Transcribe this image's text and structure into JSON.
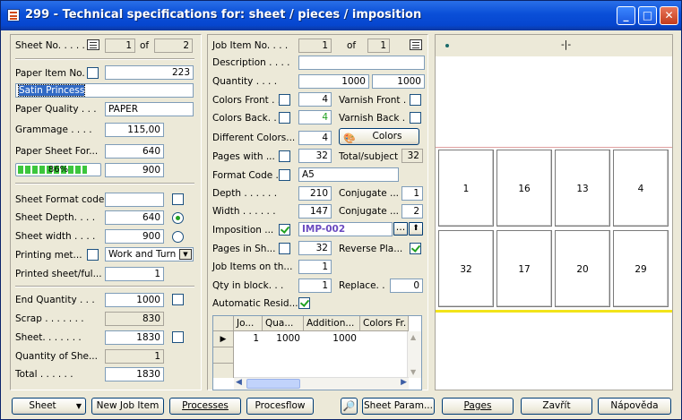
{
  "window": {
    "title": "299 - Technical specifications for: sheet / pieces / imposition",
    "minimize": "_",
    "maximize": "□",
    "close": "✕"
  },
  "left": {
    "sheet_no_label": "Sheet No. . . . .",
    "sheet_no": "1",
    "of_label": "of",
    "sheet_total": "2",
    "paper_item_label": "Paper Item No.",
    "paper_item": "223",
    "paper_name": "Satin Princess",
    "paper_quality_label": "Paper Quality . . .",
    "paper_quality": "PAPER",
    "grammage_label": "Grammage . . . .",
    "grammage": "115,00",
    "paper_sheet_label": "Paper Sheet For...",
    "paper_sheet_1": "640",
    "progress_text": "86%",
    "progress_value": 0.86,
    "paper_sheet_2": "900",
    "sheet_format_label": "Sheet Format code",
    "sheet_format": "",
    "sheet_depth_label": "Sheet Depth. . . .",
    "sheet_depth": "640",
    "sheet_width_label": "Sheet width . . . .",
    "sheet_width": "900",
    "printing_label": "Printing met...",
    "printing_method": "Work and Turn",
    "printed_label": "Printed sheet/ful...",
    "printed": "1",
    "end_qty_label": "End Quantity . . .",
    "end_qty": "1000",
    "scrap_label": "Scrap . . . . . . .",
    "scrap": "830",
    "sheet_label": "Sheet. . . . . . .",
    "sheet": "1830",
    "qty_she_label": "Quantity of She...",
    "qty_she": "1",
    "total_label": "Total . . . . . .",
    "total": "1830"
  },
  "middle": {
    "job_item_label": "Job Item No. . . .",
    "job_item": "1",
    "of_label": "of",
    "job_item_total": "1",
    "description_label": "Description . . . .",
    "description": "",
    "quantity_label": "Quantity . . . .",
    "quantity_1": "1000",
    "quantity_2": "1000",
    "colors_front_label": "Colors Front . .",
    "colors_front": "4",
    "varnish_front_label": "Varnish Front .",
    "colors_back_label": "Colors Back. . .",
    "colors_back": "4",
    "varnish_back_label": "Varnish Back .",
    "diff_colors_label": "Different Colors...",
    "diff_colors": "4",
    "colors_button": "Colors",
    "pages_with_label": "Pages with ...",
    "pages_with": "32",
    "total_subject_label": "Total/subject",
    "total_subject": "32",
    "format_code_label": "Format Code .",
    "format_code": "A5",
    "depth_label": "Depth . . . . . .",
    "depth": "210",
    "conjugate_label_1": "Conjugate ...",
    "conjugate_1": "1",
    "width_label": "Width . . . . . .",
    "width": "147",
    "conjugate_label_2": "Conjugate ...",
    "conjugate_2": "2",
    "imposition_label": "Imposition ...",
    "imposition": "IMP-002",
    "pages_in_sh_label": "Pages in Sh...",
    "pages_in_sh": "32",
    "reverse_label": "Reverse Pla...",
    "job_items_label": "Job Items on th...",
    "job_items": "1",
    "qty_block_label": "Qty in block. . .",
    "qty_block": "1",
    "replace_label": "Replace. .",
    "replace": "0",
    "auto_resid_label": "Automatic Resid...",
    "grid": {
      "headers": [
        "Jo...",
        "Qua...",
        "Addition...",
        "Colors Fr."
      ],
      "rows": [
        [
          "1",
          "1000",
          "1000",
          ""
        ]
      ]
    }
  },
  "preview": {
    "top_marker": "-|-",
    "pages_row1": [
      "1",
      "16",
      "13",
      "4"
    ],
    "pages_row2": [
      "32",
      "17",
      "20",
      "29"
    ]
  },
  "buttons": {
    "sheet": "Sheet",
    "new_job_item": "New Job Item",
    "processes": "Processes",
    "procesflow": "Procesflow",
    "sheet_param": "Sheet Param...",
    "pages": "Pages",
    "close": "Zavřít",
    "help": "Nápověda"
  },
  "colors": {
    "title_bar": "#0a4fd8",
    "selection": "#316ac5",
    "progress": "#3cc63c",
    "imposition_text": "#6b4bc0",
    "green_value": "#21a121"
  }
}
